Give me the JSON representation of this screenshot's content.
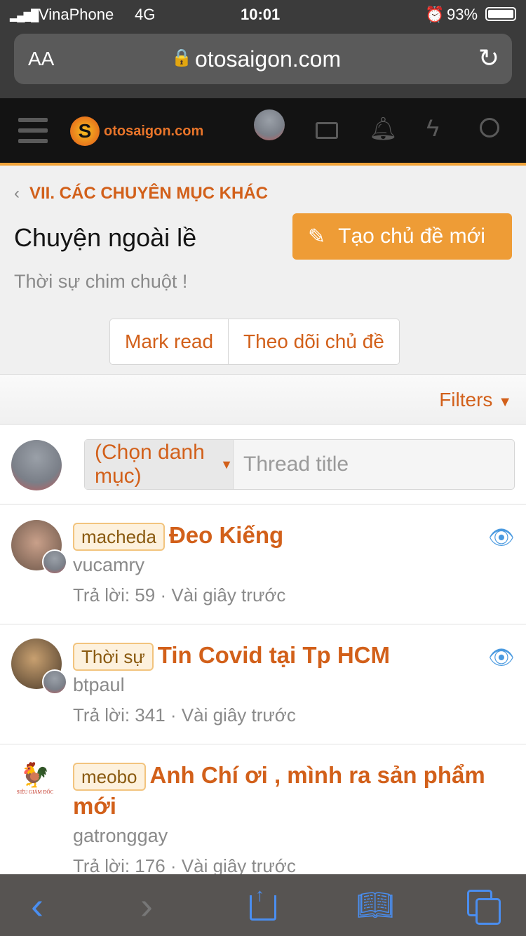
{
  "status": {
    "carrier": "VinaPhone",
    "network": "4G",
    "time": "10:01",
    "battery": "93%"
  },
  "browser": {
    "text_size": "AA",
    "url": "otosaigon.com"
  },
  "nav": {
    "logo": "otosaigon.com",
    "accent": "#f0a33a"
  },
  "forum": {
    "breadcrumb": "VII. CÁC CHUYÊN MỤC KHÁC",
    "title": "Chuyện ngoài lề",
    "new_thread": "Tạo chủ đề mới",
    "description": "Thời sự chim chuột !",
    "mark_read": "Mark read",
    "watch": "Theo dõi chủ đề",
    "filters": "Filters"
  },
  "composer": {
    "category": "(Chọn danh mục)",
    "placeholder": "Thread title"
  },
  "threads": [
    {
      "prefix": "macheda",
      "title": "Đeo Kiếng",
      "author": "vucamry",
      "meta": "Trả lời: 59 · Vài giây trước",
      "watched": true
    },
    {
      "prefix": "Thời sự",
      "title": "Tin Covid tại Tp HCM",
      "author": "btpaul",
      "meta": "Trả lời: 341 · Vài giây trước",
      "watched": true
    },
    {
      "prefix": "meobo",
      "title": "Anh Chí ơi , mình ra sản phẩm mới",
      "author": "gatronggay",
      "meta": "Trả lời: 176 · Vài giây trước",
      "watched": false,
      "avatar_text": "SIÊU GIÁM ĐỐC"
    }
  ]
}
